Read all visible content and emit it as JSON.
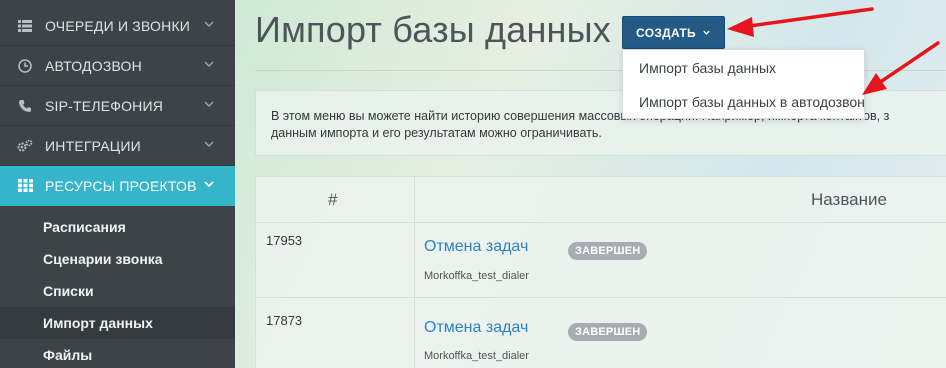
{
  "sidebar": {
    "items": [
      {
        "label": "ОЧЕРЕДИ И ЗВОНКИ",
        "icon": "list-icon"
      },
      {
        "label": "АВТОДОЗВОН",
        "icon": "clock-icon"
      },
      {
        "label": "SIP-ТЕЛЕФОНИЯ",
        "icon": "phone-icon"
      },
      {
        "label": "ИНТЕГРАЦИИ",
        "icon": "gears-icon"
      },
      {
        "label": "РЕСУРСЫ ПРОЕКТОВ",
        "icon": "grid-icon"
      }
    ],
    "subitems": [
      {
        "label": "Расписания"
      },
      {
        "label": "Сценарии звонка"
      },
      {
        "label": "Списки"
      },
      {
        "label": "Импорт данных"
      },
      {
        "label": "Файлы"
      }
    ],
    "active_color": "#34b5c9"
  },
  "page": {
    "title": "Импорт базы данных",
    "create_button": "СОЗДАТЬ",
    "dropdown": [
      "Импорт базы данных",
      "Импорт базы данных в автодозвон"
    ],
    "info_line1": "В этом меню вы можете найти историю совершения массовых операций. Например, импорта контактов, з",
    "info_line2": "данным импорта и его результатам можно ограничивать.",
    "columns": {
      "id": "#",
      "name": "Название"
    },
    "rows": [
      {
        "id": "17953",
        "name": "Отмена задач",
        "status": "ЗАВЕРШЕН",
        "dialer": "Morkoffka_test_dialer"
      },
      {
        "id": "17873",
        "name": "Отмена задач",
        "status": "ЗАВЕРШЕН",
        "dialer": "Morkoffka_test_dialer"
      }
    ]
  },
  "colors": {
    "button": "#235a86",
    "link": "#2e82c3",
    "badge": "#a6adb2",
    "annotation_arrow": "#e8141b"
  }
}
